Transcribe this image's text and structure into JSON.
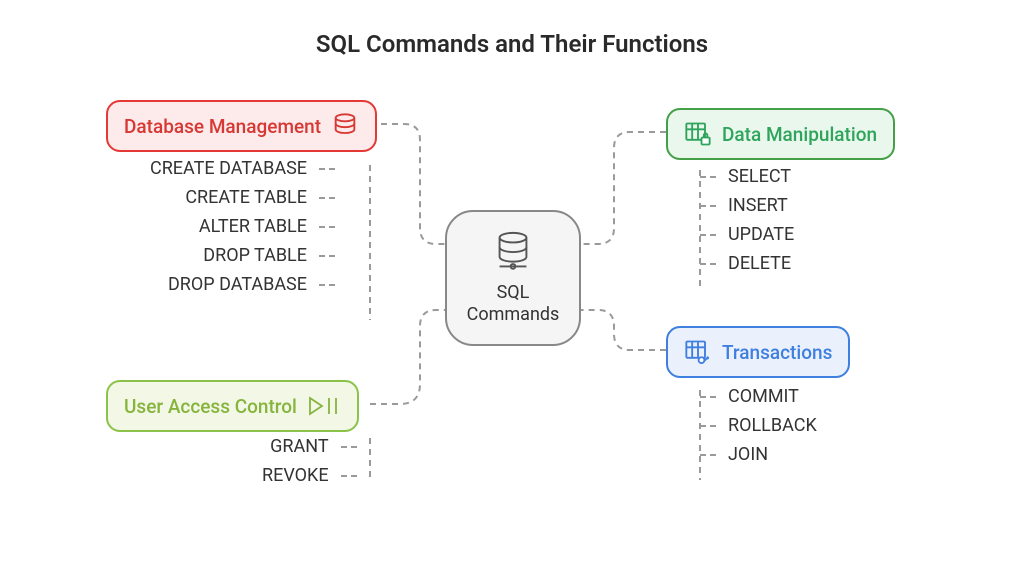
{
  "title": "SQL Commands and Their Functions",
  "center": {
    "label": "SQL\nCommands"
  },
  "branches": {
    "db_mgmt": {
      "label": "Database Management",
      "commands": [
        "CREATE DATABASE",
        "CREATE TABLE",
        "ALTER TABLE",
        "DROP TABLE",
        "DROP DATABASE"
      ]
    },
    "data_manip": {
      "label": "Data Manipulation",
      "commands": [
        "SELECT",
        "INSERT",
        "UPDATE",
        "DELETE"
      ]
    },
    "user_access": {
      "label": "User Access Control",
      "commands": [
        "GRANT",
        "REVOKE"
      ]
    },
    "transactions": {
      "label": "Transactions",
      "commands": [
        "COMMIT",
        "ROLLBACK",
        "JOIN"
      ]
    }
  }
}
